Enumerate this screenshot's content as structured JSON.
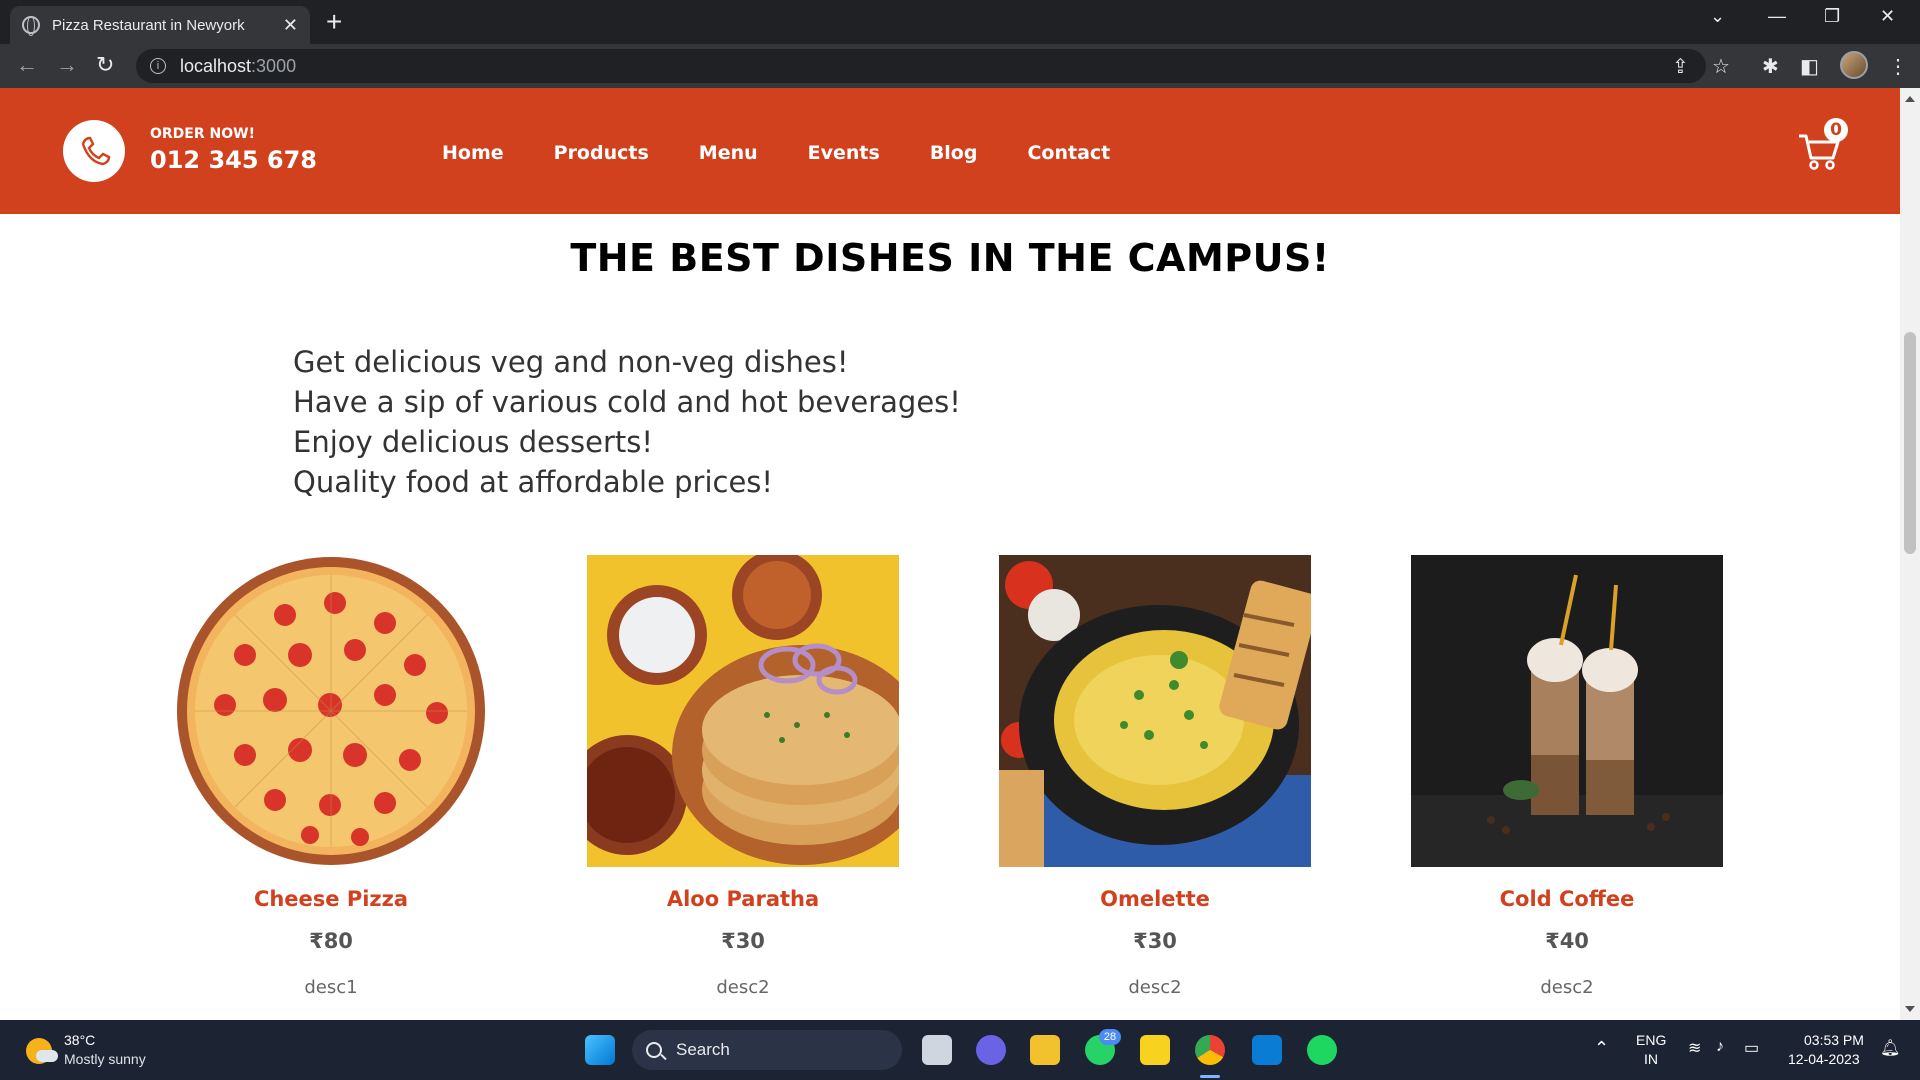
{
  "browser": {
    "tab_title": "Pizza Restaurant in Newyork",
    "url_host": "localhost",
    "url_port": ":3000"
  },
  "header": {
    "order_label": "ORDER NOW!",
    "phone": "012 345 678",
    "nav": [
      "Home",
      "Products",
      "Menu",
      "Events",
      "Blog",
      "Contact"
    ],
    "cart_count": "0",
    "brand_color": "#d1411e"
  },
  "main": {
    "headline": "THE BEST DISHES IN THE CAMPUS!",
    "features": [
      "Get delicious veg and non-veg dishes!",
      "Have a sip of various cold and hot beverages!",
      "Enjoy delicious desserts!",
      "Quality food at affordable prices!"
    ],
    "products": [
      {
        "name": "Cheese Pizza",
        "price": "₹80",
        "desc": "desc1"
      },
      {
        "name": "Aloo Paratha",
        "price": "₹30",
        "desc": "desc2"
      },
      {
        "name": "Omelette",
        "price": "₹30",
        "desc": "desc2"
      },
      {
        "name": "Cold Coffee",
        "price": "₹40",
        "desc": "desc2"
      }
    ]
  },
  "taskbar": {
    "temp": "38°C",
    "weather": "Mostly sunny",
    "search": "Search",
    "whatsapp_badge": "28",
    "lang": "ENG",
    "region": "IN",
    "time": "03:53 PM",
    "date": "12-04-2023"
  }
}
